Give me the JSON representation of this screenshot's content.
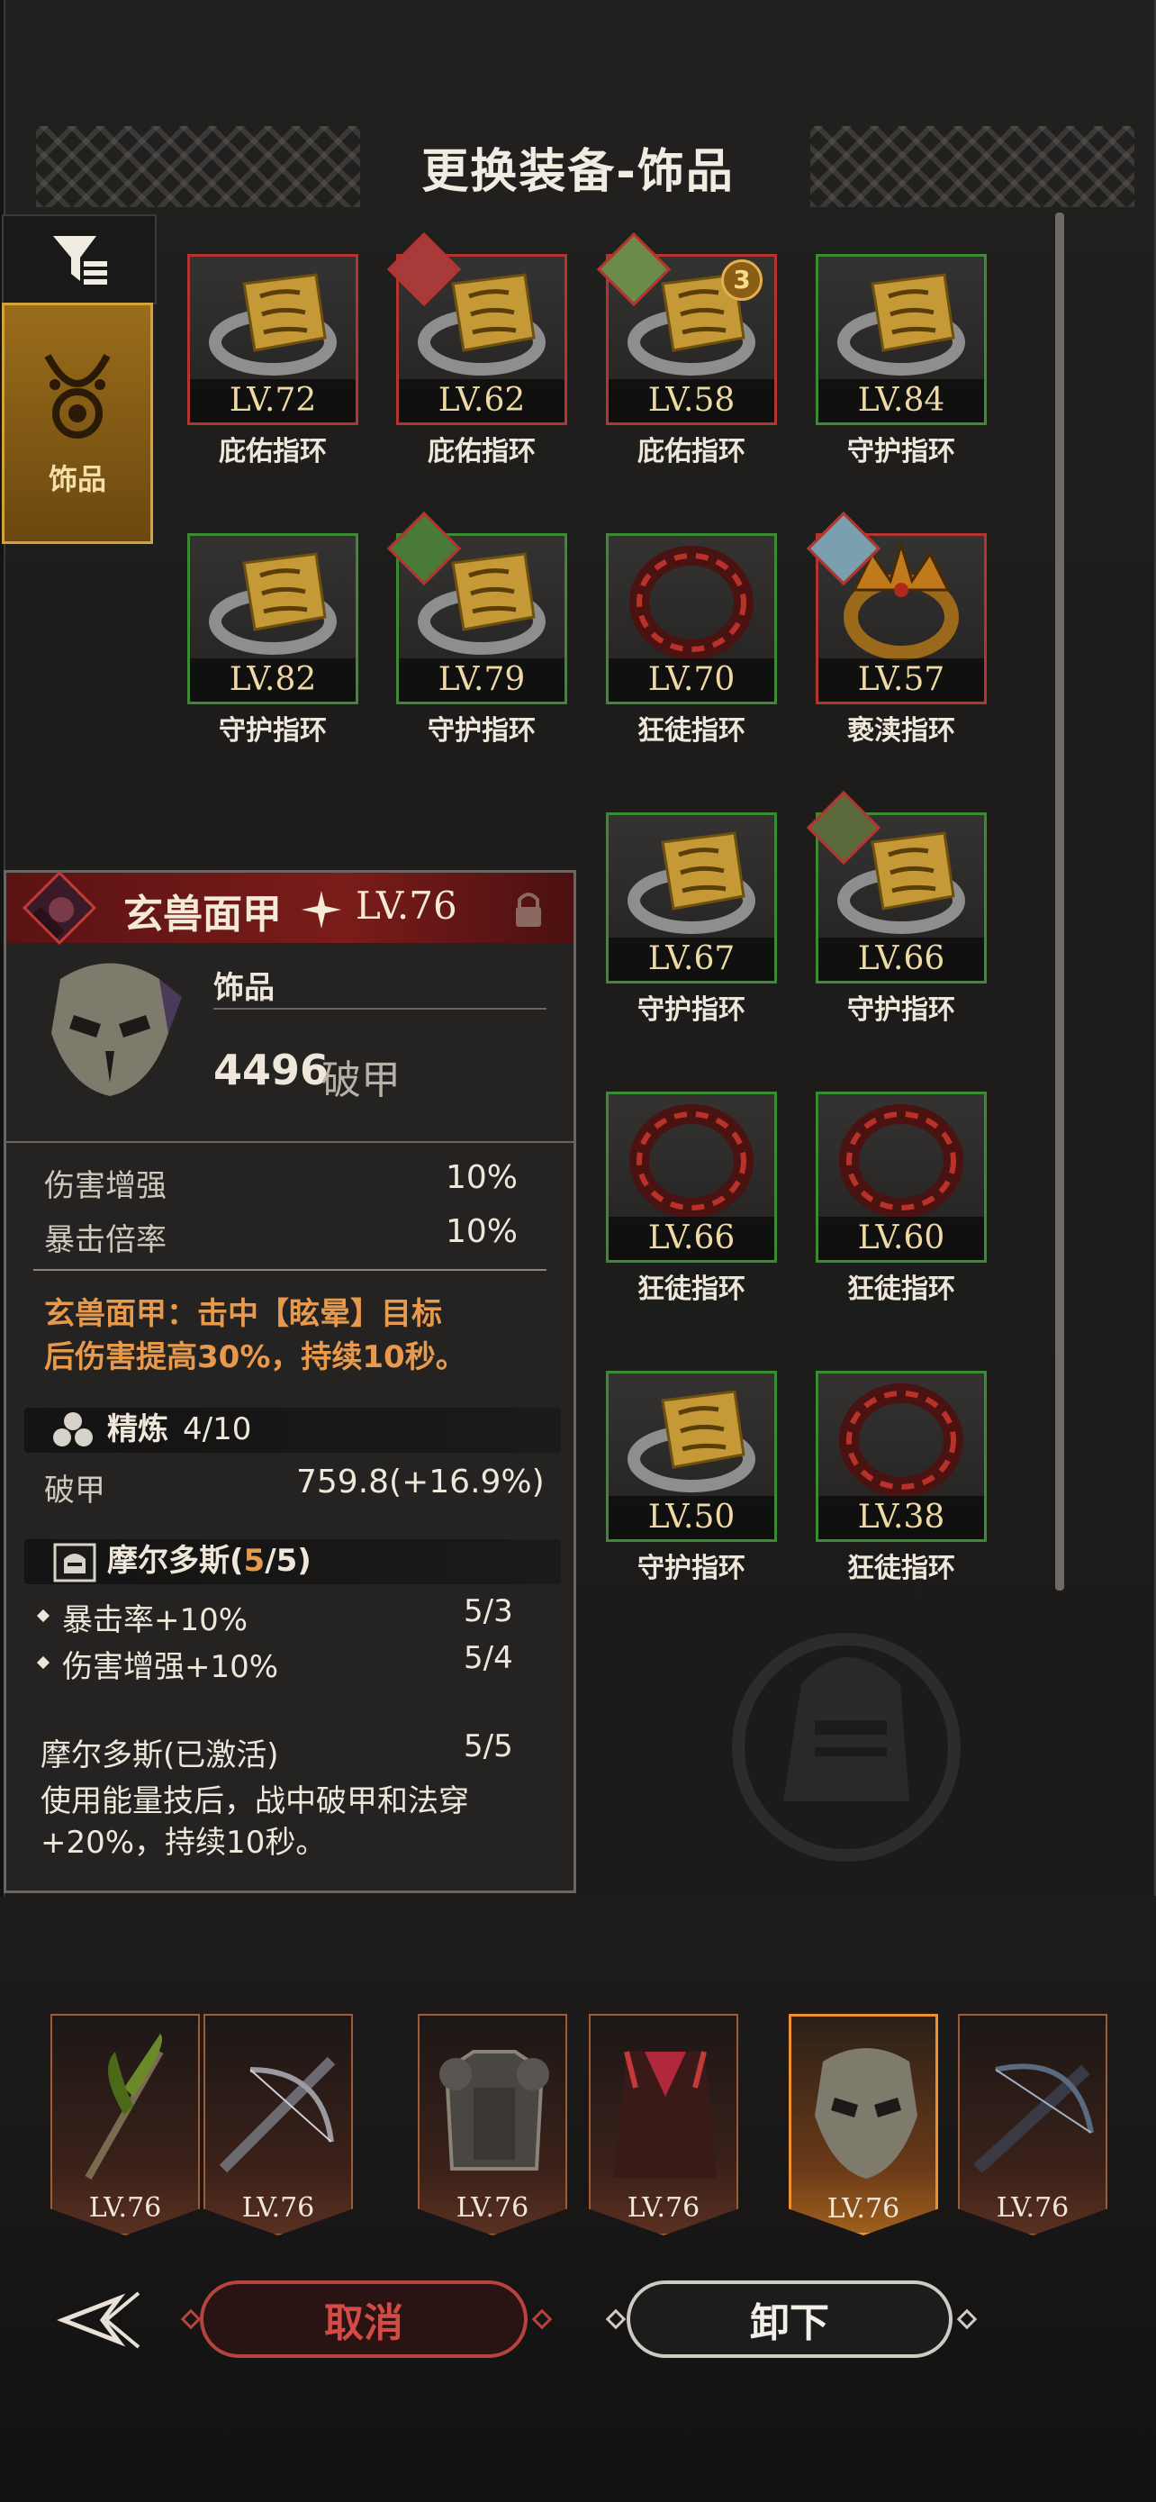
{
  "title": "更换装备-饰品",
  "category": {
    "label": "饰品"
  },
  "colors": {
    "green_border": "#3b8a34",
    "red_border": "#b43430",
    "gold": "#d4a23a",
    "cancel_red": "#d24b44"
  },
  "items": [
    {
      "level": "LV.72",
      "name": "庇佑指环",
      "rarity": "red",
      "type": "gold-ring",
      "portrait": false
    },
    {
      "level": "LV.62",
      "name": "庇佑指环",
      "rarity": "red",
      "type": "gold-ring",
      "portrait": true
    },
    {
      "level": "LV.58",
      "name": "庇佑指环",
      "rarity": "red",
      "type": "gold-ring",
      "portrait": true,
      "badge": "3"
    },
    {
      "level": "LV.84",
      "name": "守护指环",
      "rarity": "green",
      "type": "gold-ring",
      "portrait": false
    },
    {
      "level": "LV.82",
      "name": "守护指环",
      "rarity": "green",
      "type": "gold-ring",
      "portrait": false
    },
    {
      "level": "LV.79",
      "name": "守护指环",
      "rarity": "green",
      "type": "gold-ring",
      "portrait": true
    },
    {
      "level": "LV.70",
      "name": "狂徒指环",
      "rarity": "green",
      "type": "red-ring",
      "portrait": false
    },
    {
      "level": "LV.57",
      "name": "亵渎指环",
      "rarity": "red",
      "type": "crown-ring",
      "portrait": true
    },
    {
      "level": "LV.67",
      "name": "守护指环",
      "rarity": "green",
      "type": "gold-ring",
      "portrait": false
    },
    {
      "level": "LV.66",
      "name": "守护指环",
      "rarity": "green",
      "type": "gold-ring",
      "portrait": true
    },
    {
      "level": "LV.66",
      "name": "狂徒指环",
      "rarity": "green",
      "type": "red-ring",
      "portrait": false
    },
    {
      "level": "LV.60",
      "name": "狂徒指环",
      "rarity": "green",
      "type": "red-ring",
      "portrait": false
    },
    {
      "level": "LV.50",
      "name": "守护指环",
      "rarity": "green",
      "type": "gold-ring",
      "portrait": false
    },
    {
      "level": "LV.38",
      "name": "狂徒指环",
      "rarity": "green",
      "type": "red-ring",
      "portrait": false
    }
  ],
  "detail": {
    "name": "玄兽面甲",
    "level": "LV.76",
    "category": "饰品",
    "main_stat_value": "4496",
    "main_stat_label": "破甲",
    "stats": [
      {
        "label": "伤害增强",
        "value": "10%"
      },
      {
        "label": "暴击倍率",
        "value": "10%"
      }
    ],
    "effect_line1": "玄兽面甲：击中【眩晕】目标",
    "effect_line2": "后伤害提高30%，持续10秒。",
    "refine_label": "精炼",
    "refine_value": "4/10",
    "refine_stat_label": "破甲",
    "refine_stat_value": "759.8(+16.9%)",
    "set_name": "摩尔多斯",
    "set_count_open": "(",
    "set_count_current": "5",
    "set_count_total": "/5)",
    "set_bonuses": [
      {
        "label": "暴击率+10%",
        "value": "5/3"
      },
      {
        "label": "伤害增强+10%",
        "value": "5/4"
      }
    ],
    "set_active_label": "摩尔多斯(已激活)",
    "set_active_value": "5/5",
    "set_desc_line1": "使用能量技后，战中破甲和法穿",
    "set_desc_line2": "+20%，持续10秒。"
  },
  "gear": [
    {
      "level": "LV.76",
      "type": "feather-staff"
    },
    {
      "level": "LV.76",
      "type": "crossbow"
    },
    {
      "level": "LV.76",
      "type": "armor"
    },
    {
      "level": "LV.76",
      "type": "cape"
    },
    {
      "level": "LV.76",
      "type": "mask",
      "active": true
    },
    {
      "level": "LV.76",
      "type": "crossbow-dark"
    }
  ],
  "buttons": {
    "cancel": "取消",
    "unload": "卸下"
  }
}
